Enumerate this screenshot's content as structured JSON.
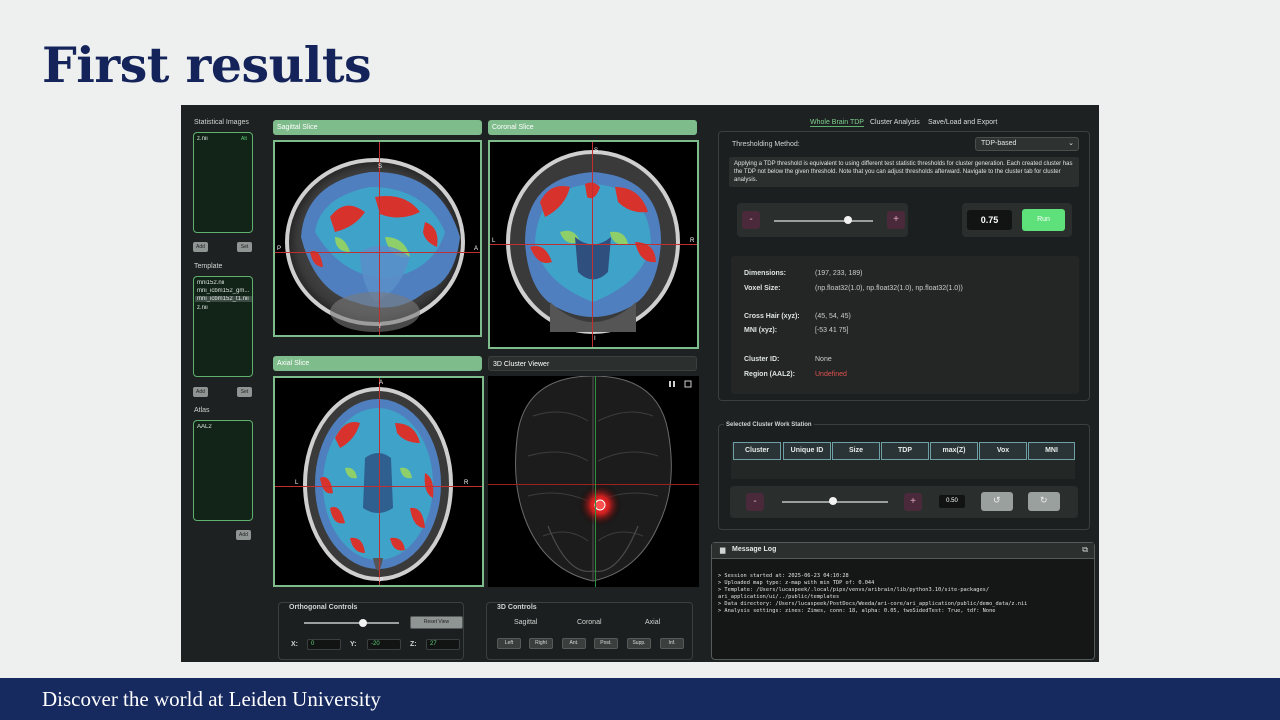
{
  "slide": {
    "title": "First results",
    "footer": "Discover the world at Leiden University"
  },
  "colors": {
    "accent_green": "#7fbc8c",
    "navy": "#172a5f",
    "run_green": "#5ee07a",
    "error_red": "#e05050"
  },
  "left": {
    "stat_title": "Statistical Images",
    "stat_items": [
      "z.nii"
    ],
    "stat_badge": "Alt",
    "add_label": "Add",
    "set_label": "Set",
    "template_title": "Template",
    "template_items": [
      "mni152.nii",
      "mni_icbm152_gm...",
      "mni_icbm152_t1.nii",
      "z.nii"
    ],
    "atlas_title": "Atlas",
    "atlas_items": [
      "AAL2"
    ]
  },
  "views": {
    "sagittal": "Sagittal Slice",
    "coronal": "Coronal Slice",
    "axial": "Axial Slice",
    "cluster3d": "3D Cluster Viewer",
    "labels": {
      "s": "S",
      "i": "I",
      "p": "P",
      "a": "A",
      "l": "L",
      "r": "R"
    },
    "icons": [
      "pause-icon",
      "fullscreen-icon"
    ]
  },
  "ortho": {
    "title": "Orthogonal Controls",
    "reset": "Reset View",
    "x_label": "X:",
    "x": "0",
    "y_label": "Y:",
    "y": "-20",
    "z_label": "Z:",
    "z": "27",
    "slider_level": 0.62
  },
  "controls3d": {
    "title": "3D Controls",
    "sagittal": "Sagittal",
    "coronal": "Coronal",
    "axial": "Axial",
    "buttons": [
      "Left",
      "Right",
      "Ant.",
      "Post.",
      "Supp.",
      "Inf."
    ]
  },
  "tabs": [
    "Whole Brain TDP",
    "Cluster Analysis",
    "Save/Load and Export"
  ],
  "threshold": {
    "method_label": "Thresholding Method:",
    "method_value": "TDP-based",
    "description": "Applying a TDP threshold is equivalent to using different test statistic thresholds for cluster generation. Each created cluster has the TDP not below the given threshold. Note that you can adjust thresholds afterward. Navigate to the cluster tab for cluster analysis.",
    "minus": "-",
    "plus": "+",
    "value": "0.75",
    "run": "Run",
    "slider_level": 0.75
  },
  "info": {
    "dimensions_label": "Dimensions:",
    "dimensions": "(197, 233, 189)",
    "voxel_label": "Voxel Size:",
    "voxel": "(np.float32(1.0), np.float32(1.0), np.float32(1.0))",
    "crosshair_label": "Cross Hair (xyz):",
    "crosshair": "(45, 54, 45)",
    "mni_label": "MNI (xyz):",
    "mni": "[-53 41 75]",
    "cluster_label": "Cluster ID:",
    "cluster": "None",
    "region_label": "Region (AAL2):",
    "region": "Undefined"
  },
  "station": {
    "title": "Selected Cluster Work Station",
    "columns": [
      "Cluster",
      "Unique ID",
      "Size",
      "TDP",
      "max(Z)",
      "Vox",
      "MNI"
    ],
    "minus": "-",
    "plus": "+",
    "value": "0.50",
    "slider_level": 0.48
  },
  "log": {
    "title": "Message Log",
    "lines": [
      "> Session started at: 2025-06-23 04:10:28",
      "> Uploaded map type: z-map with min TDP of: 0.044",
      "> Template: /Users/lucaspeek/.local/pipx/venvs/aribrain/lib/python3.10/site-packages/",
      "ari_application/ui/../public/templates",
      "> Data directory: /Users/lucaspeek/PostDocs/Weeda/ari-core/ari_application/public/demo_data/z.nii",
      "> Analysis settings: zines: Zimes, conn: 18, alpha: 0.05, twoSidedTest: True, tdf: None"
    ]
  }
}
